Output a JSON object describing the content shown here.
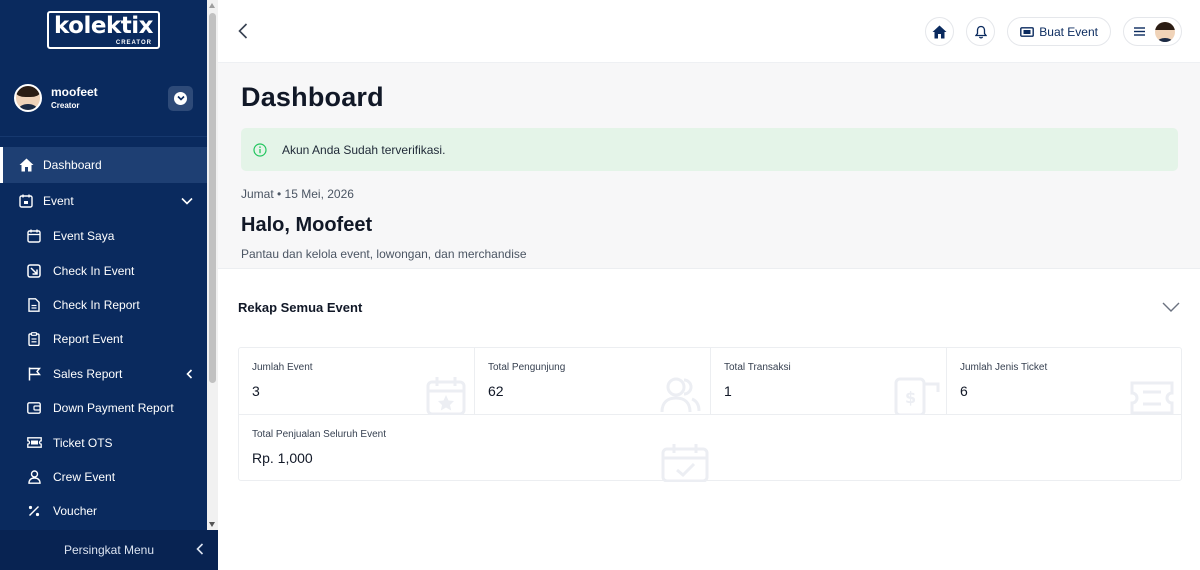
{
  "sidebar": {
    "logo_text": "kolektix",
    "logo_sub": "CREATOR",
    "profile": {
      "name": "moofeet",
      "role": "Creator"
    },
    "items": [
      {
        "label": "Dashboard",
        "icon": "home-icon"
      },
      {
        "label": "Event",
        "icon": "calendar-star-icon"
      },
      {
        "label": "Event Saya",
        "icon": "calendar-icon"
      },
      {
        "label": "Check In Event",
        "icon": "check-in-icon"
      },
      {
        "label": "Check In Report",
        "icon": "document-icon"
      },
      {
        "label": "Report Event",
        "icon": "clipboard-icon"
      },
      {
        "label": "Sales Report",
        "icon": "flag-icon"
      },
      {
        "label": "Down Payment Report",
        "icon": "wallet-icon"
      },
      {
        "label": "Ticket OTS",
        "icon": "ticket-icon"
      },
      {
        "label": "Crew Event",
        "icon": "user-icon"
      },
      {
        "label": "Voucher",
        "icon": "percent-icon"
      }
    ],
    "collapse_label": "Persingkat Menu"
  },
  "topbar": {
    "create_event_label": "Buat Event"
  },
  "hero": {
    "title": "Dashboard",
    "alert": "Akun Anda Sudah terverifikasi.",
    "date": "Jumat • 15 Mei, 2026",
    "greeting": "Halo, Moofeet",
    "subtitle": "Pantau dan kelola event, lowongan, dan merchandise"
  },
  "section": {
    "title": "Rekap Semua Event"
  },
  "stats": [
    {
      "label": "Jumlah Event",
      "value": "3",
      "icon": "calendar-star-icon"
    },
    {
      "label": "Total Pengunjung",
      "value": "62",
      "icon": "users-icon"
    },
    {
      "label": "Total Transaksi",
      "value": "1",
      "icon": "money-icon"
    },
    {
      "label": "Jumlah Jenis Ticket",
      "value": "6",
      "icon": "ticket-icon"
    },
    {
      "label": "Total Penjualan Seluruh Event",
      "value": "Rp. 1,000",
      "icon": "calendar-check-icon"
    }
  ],
  "colors": {
    "sidebar_bg": "#0a2a5e",
    "active_item": "#1e3f73",
    "alert_bg": "#e4f4e8",
    "success": "#22c55e"
  }
}
